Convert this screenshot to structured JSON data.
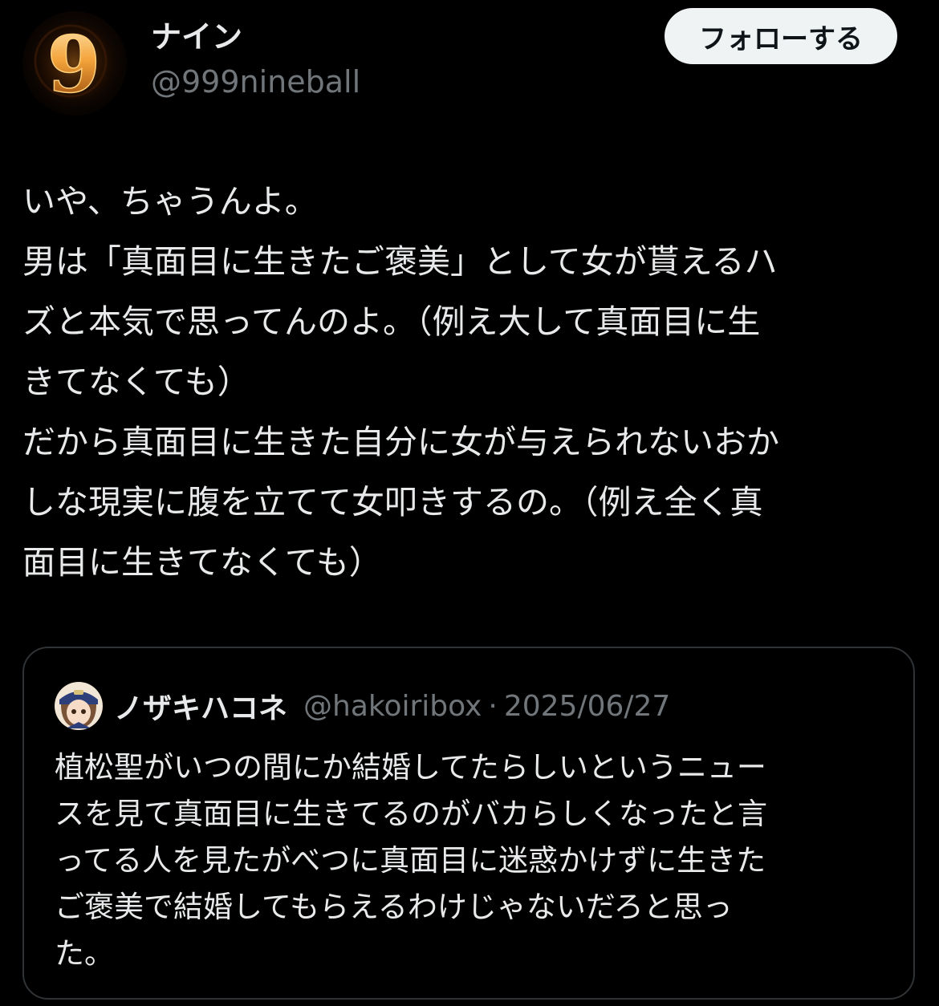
{
  "post": {
    "author_name": "ナイン",
    "author_handle": "@999nineball",
    "avatar_icon": "nine-ball-glow-avatar",
    "follow_label": "フォローする",
    "text_lines": [
      "いや、ちゃうんよ。",
      "男は「真面目に生きたご褒美」として女が貰えるハ",
      "ズと本気で思ってんのよ。（例え大して真面目に生",
      "きてなくても）",
      "だから真面目に生きた自分に女が与えられないおか",
      "しな現実に腹を立てて女叩きするの。（例え全く真",
      "面目に生きてなくても）"
    ]
  },
  "quote": {
    "author_name": "ノザキハコネ",
    "author_handle": "@hakoiribox",
    "separator": "·",
    "date": "2025/06/27",
    "avatar_icon": "anime-character-avatar",
    "text_lines": [
      "植松聖がいつの間にか結婚してたらしいというニュー",
      "スを見て真面目に生きてるのがバカらしくなったと言",
      "ってる人を見たがべつに真面目に迷惑かけずに生きた",
      "ご褒美で結婚してもらえるわけじゃないだろと思っ",
      "た。"
    ]
  },
  "colors": {
    "background": "#000000",
    "primary_text": "#e7e9ea",
    "secondary_text": "#71767b",
    "border": "#2f3336",
    "follow_button_bg": "#eff3f4",
    "follow_button_text": "#0f1419"
  }
}
